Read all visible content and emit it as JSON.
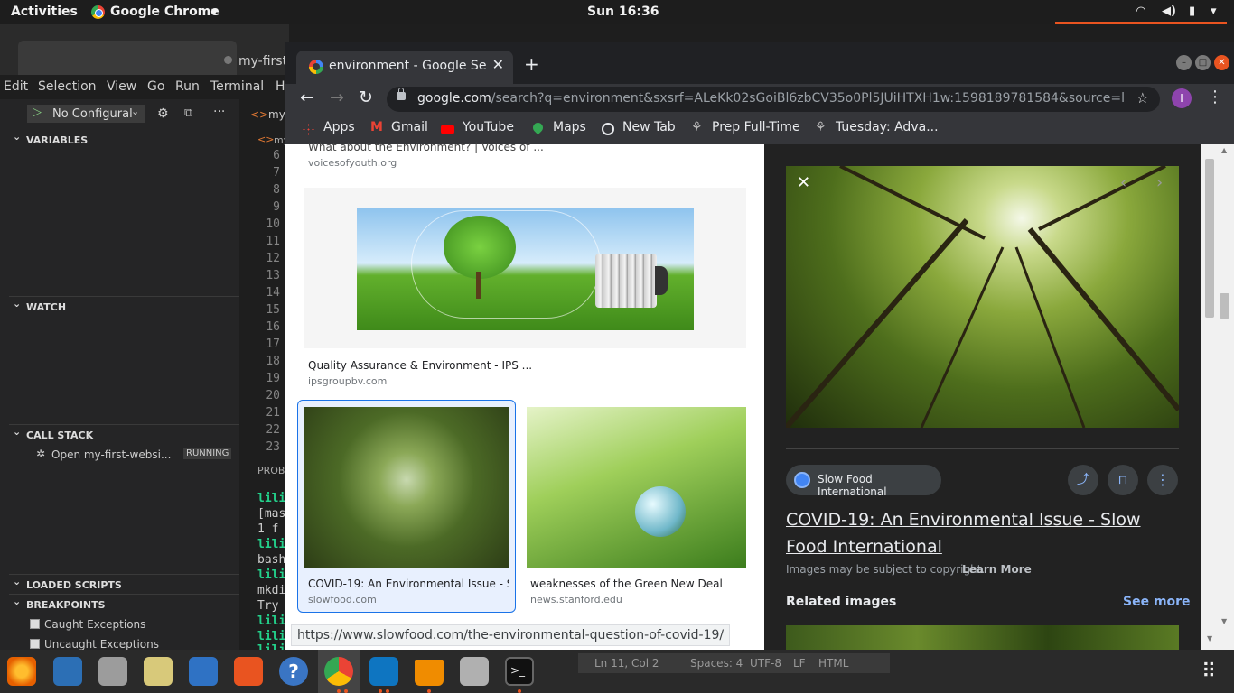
{
  "topbar": {
    "activities": "Activities",
    "app": "Google Chrome",
    "app_arrow": "▾",
    "clock": "Sun 16:36",
    "wifi": "wifi-icon",
    "volume": "volume-icon",
    "battery": "battery-icon",
    "power_arrow": "▾"
  },
  "vscode": {
    "title_tab": "my-first",
    "menu": [
      "Edit",
      "Selection",
      "View",
      "Go",
      "Run",
      "Terminal",
      "H"
    ],
    "debug_config": "No Configural",
    "editor_tab": "my-",
    "breadcrumb": "my",
    "sections": {
      "variables": "VARIABLES",
      "watch": "WATCH",
      "call_stack": "CALL STACK",
      "loaded_scripts": "LOADED SCRIPTS",
      "breakpoints": "BREAKPOINTS"
    },
    "call_stack_item": "Open my-first-websi...",
    "running_badge": "RUNNING",
    "caught": "Caught Exceptions",
    "uncaught": "Uncaught Exceptions",
    "line_numbers": [
      "6",
      "7",
      "8",
      "9",
      "10",
      "11",
      "12",
      "13",
      "14",
      "15",
      "16",
      "17",
      "18",
      "19",
      "20",
      "21",
      "22",
      "23"
    ],
    "panel_tab": "PROBI",
    "terminal_lines": [
      "lili",
      "[mas",
      " 1 f",
      "lili",
      "bash",
      "lili",
      "mkdi",
      "Try ",
      "lili",
      "lili",
      "lili"
    ],
    "status": {
      "ln": "Ln 11, Col 2",
      "spaces": "Spaces: 4",
      "enc": "UTF-8",
      "eol": "LF",
      "lang": "HTML"
    }
  },
  "chrome": {
    "tab_title": "environment - Google Sea",
    "tab_close": "✕",
    "new_tab": "+",
    "url_host": "google.com",
    "url_rest": "/search?q=environment&sxsrf=ALeKk02sGoiBl6zbCV35o0Pl5JUiHTXH1w:1598189781584&source=lnms&tbm...",
    "avatar_letter": "I",
    "bookmarks": [
      "Apps",
      "Gmail",
      "YouTube",
      "Maps",
      "New Tab",
      "Prep Full-Time",
      "Tuesday: Adva..."
    ]
  },
  "results": [
    {
      "caption": "What about the Environment? | Voices of ...",
      "source": "voicesofyouth.org"
    },
    {
      "caption": "Quality Assurance & Environment - IPS ...",
      "source": "ipsgroupbv.com"
    },
    {
      "caption": "COVID-19: An Environmental Issue - Sl...",
      "source": "slowfood.com"
    },
    {
      "caption": "weaknesses of the Green New Deal",
      "source": "news.stanford.edu"
    }
  ],
  "panel": {
    "source": "Slow Food International",
    "title": "COVID-19: An Environmental Issue - Slow Food International",
    "copyright": "Images may be subject to copyright.",
    "learn_more": "Learn More",
    "related": "Related images",
    "see_more": "See more"
  },
  "status_url": "https://www.slowfood.com/the-environmental-question-of-covid-19/",
  "colors": {
    "accent": "#8ab4f8",
    "selected_border": "#1a73e8",
    "vscode_run": "#89d185"
  }
}
